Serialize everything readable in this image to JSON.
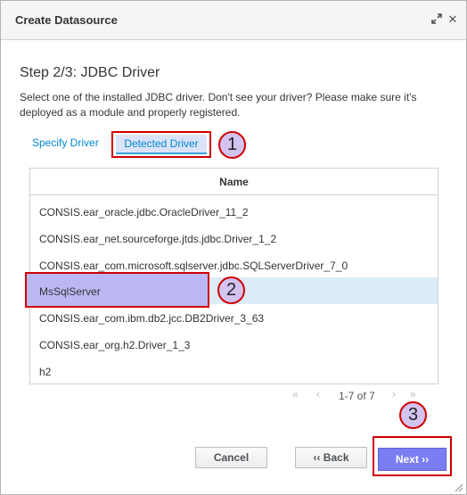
{
  "dialog": {
    "title": "Create Datasource",
    "maximize_icon": "expand-icon",
    "close_label": "✕"
  },
  "step": {
    "title": "Step 2/3: JDBC Driver",
    "description": "Select one of the installed JDBC driver. Don't see your driver? Please make sure it's deployed as a module and properly registered."
  },
  "tabs": {
    "specify": "Specify Driver",
    "detected": "Detected Driver"
  },
  "table": {
    "column_header": "Name",
    "rows": [
      "CONSIS.ear_oracle.jdbc.OracleDriver_11_2",
      "CONSIS.ear_net.sourceforge.jtds.jdbc.Driver_1_2",
      "CONSIS.ear_com.microsoft.sqlserver.jdbc.SQLServerDriver_7_0",
      "MsSqlServer",
      "CONSIS.ear_com.ibm.db2.jcc.DB2Driver_3_63",
      "CONSIS.ear_org.h2.Driver_1_3",
      "h2"
    ],
    "selected_row": "MsSqlServer"
  },
  "pager": {
    "text": "1-7 of 7",
    "first": "«",
    "prev": "‹",
    "next": "›",
    "last": "»"
  },
  "buttons": {
    "cancel": "Cancel",
    "back": "‹‹ Back",
    "next": "Next ››"
  },
  "markers": [
    "1",
    "2",
    "3"
  ],
  "colors": {
    "link": "#0088ce",
    "highlight": "#d00000",
    "marker_fill": "#d2c3f0",
    "next_button": "#7a7df2",
    "selected_row": "#dcecf8"
  }
}
